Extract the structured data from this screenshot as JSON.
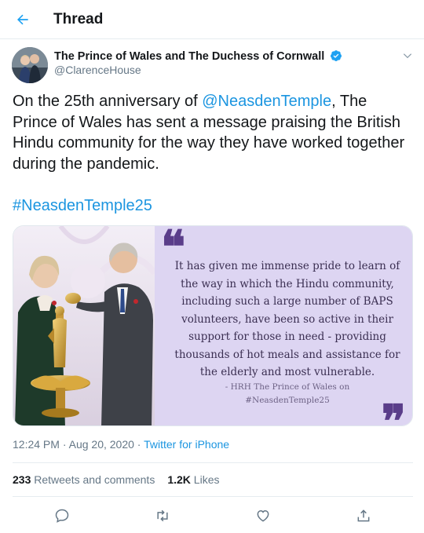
{
  "header": {
    "title": "Thread",
    "back_icon": "arrow-left-icon"
  },
  "author": {
    "name": "The Prince of Wales and The Duchess of Cornwall",
    "handle": "@ClarenceHouse",
    "verified_icon": "verified-badge-icon",
    "verified_color": "#1da1f2"
  },
  "tweet": {
    "text_part1": "On the 25th anniversary of ",
    "mention": "@NeasdenTemple",
    "text_part2": ", The Prince of Wales has sent a message praising the British Hindu community for the way they have worked together during the pandemic.",
    "hashtag": "#NeasdenTemple25",
    "link_color": "#1b95e0"
  },
  "media": {
    "quote_open": "❝",
    "quote_body": "It has given me immense pride to learn of the way in which the Hindu community, including such a large number of BAPS volunteers, have been so active in their support for those in need - providing thousands of hot meals and assistance for the elderly and most vulnerable.",
    "attribution_line1": "- HRH The Prince of Wales on",
    "attribution_line2": "#NeasdenTemple25",
    "quote_close": "❞",
    "panel_color": "#ddd5f2"
  },
  "meta": {
    "time": "12:24 PM",
    "separator": " · ",
    "date": "Aug 20, 2020",
    "separator2": " · ",
    "source": "Twitter for iPhone"
  },
  "stats": {
    "retweets_count": "233",
    "retweets_label": " Retweets and comments",
    "likes_count": "1.2K",
    "likes_label": " Likes"
  },
  "actions": [
    "reply-icon",
    "retweet-icon",
    "like-icon",
    "share-icon"
  ]
}
